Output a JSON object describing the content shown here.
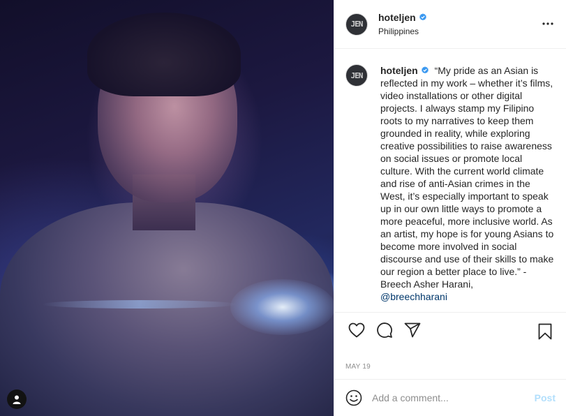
{
  "post": {
    "username": "hoteljen",
    "location": "Philippines",
    "avatar_text": "JEN",
    "caption": "“My pride as an Asian is reflected in my work – whether it’s films, video installations or other digital projects. I always stamp my Filipino roots to my narratives to keep them grounded in reality, while exploring creative possibilities to raise awareness on social issues or promote local culture. With the current world climate and rise of anti-Asian crimes in the West, it’s especially important to speak up in our own little ways to promote a more peaceful, more inclusive world. As an artist, my hope is for young Asians to become more involved in social discourse and use of their skills to make our region a better place to live.” - Breech Asher Harani,",
    "mention": "@breechharani",
    "date": "MAY 19"
  },
  "comment": {
    "placeholder": "Add a comment...",
    "post_label": "Post"
  },
  "icons": {
    "verified": "verified-badge-icon",
    "more": "more-options-icon",
    "like": "heart-icon",
    "comment": "comment-bubble-icon",
    "share": "paper-plane-icon",
    "save": "bookmark-icon",
    "emoji": "emoji-icon",
    "tagged_user": "user-icon"
  },
  "colors": {
    "verified": "#3897f0",
    "mention": "#00376b",
    "post_disabled": "#b2dffc",
    "muted": "#8e8e8e"
  }
}
